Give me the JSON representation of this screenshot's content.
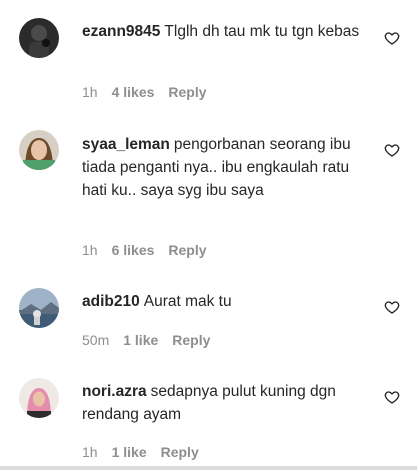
{
  "comments": [
    {
      "username": "ezann9845",
      "text": "Tlglh dh tau mk tu tgn kebas",
      "time": "1h",
      "likes": "4 likes",
      "reply": "Reply",
      "avatar_icon": "avatar-dark-icon"
    },
    {
      "username": "syaa_leman",
      "text": "pengorbanan seorang ibu tiada penganti nya.. ibu engkaulah ratu hati ku.. saya syg ibu saya",
      "time": "1h",
      "likes": "6 likes",
      "reply": "Reply",
      "avatar_icon": "avatar-woman-icon"
    },
    {
      "username": "adib210",
      "text": "Aurat mak tu",
      "time": "50m",
      "likes": "1 like",
      "reply": "Reply",
      "avatar_icon": "avatar-landscape-icon"
    },
    {
      "username": "nori.azra",
      "text": "sedapnya pulut kuning dgn rendang ayam",
      "time": "1h",
      "likes": "1 like",
      "reply": "Reply",
      "avatar_icon": "avatar-hijab-icon"
    }
  ],
  "colors": {
    "text": "#262626",
    "meta": "#8e8e8e",
    "heart_stroke": "#262626"
  },
  "icons": {
    "like": "heart-outline-icon"
  }
}
